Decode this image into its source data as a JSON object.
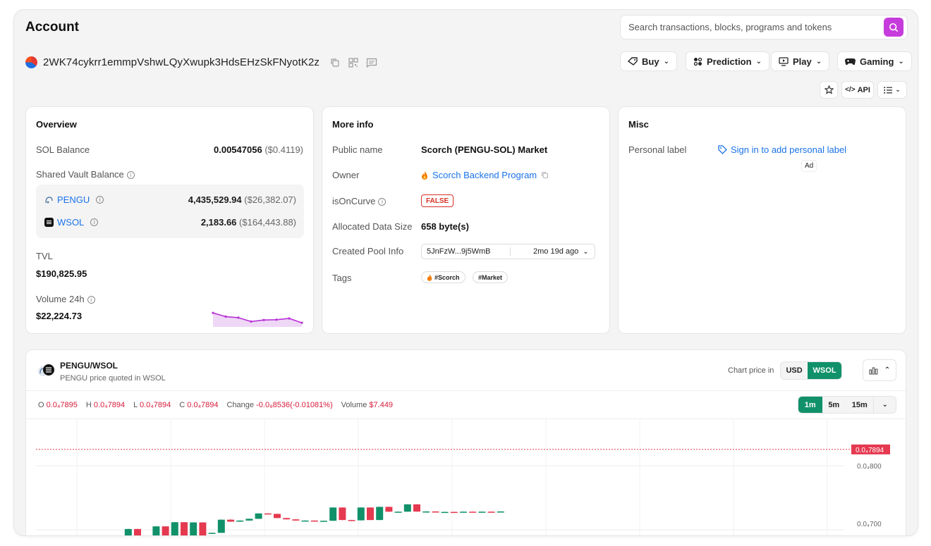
{
  "header": {
    "title": "Account",
    "search_placeholder": "Search transactions, blocks, programs and tokens"
  },
  "account": {
    "address": "2WK74cykrr1emmpVshwLQyXwupk3HdsEHzSkFNyotK2z"
  },
  "nav": {
    "buy": "Buy",
    "prediction": "Prediction",
    "play": "Play",
    "gaming": "Gaming",
    "api": "API"
  },
  "overview": {
    "title": "Overview",
    "sol_balance_label": "SOL Balance",
    "sol_balance_value": "0.00547056",
    "sol_balance_usd": "($0.4119)",
    "vault_label": "Shared Vault Balance",
    "vault": [
      {
        "token": "PENGU",
        "amount": "4,435,529.94",
        "usd": "($26,382.07)"
      },
      {
        "token": "WSOL",
        "amount": "2,183.66",
        "usd": "($164,443.88)"
      }
    ],
    "tvl_label": "TVL",
    "tvl_value": "$190,825.95",
    "volume_label": "Volume 24h",
    "volume_value": "$22,224.73",
    "sparkline": [
      0.86,
      0.62,
      0.55,
      0.3,
      0.4,
      0.42,
      0.5,
      0.22
    ]
  },
  "more_info": {
    "title": "More info",
    "public_name_label": "Public name",
    "public_name_value": "Scorch (PENGU-SOL) Market",
    "owner_label": "Owner",
    "owner_value": "Scorch Backend Program",
    "is_on_curve_label": "isOnCurve",
    "is_on_curve_value": "FALSE",
    "data_size_label": "Allocated Data Size",
    "data_size_value": "658 byte(s)",
    "pool_label": "Created Pool Info",
    "pool_tx": "5JnFzW...9j5WmB",
    "pool_age": "2mo 19d ago",
    "tags_label": "Tags",
    "tags": [
      "#Scorch",
      "#Market"
    ]
  },
  "misc": {
    "title": "Misc",
    "personal_label": "Personal label",
    "sign_in_link": "Sign in to add personal label",
    "ad": "Ad"
  },
  "chart_panel": {
    "pair": "PENGU/WSOL",
    "subtitle": "PENGU price quoted in WSOL",
    "price_in_label": "Chart price in",
    "currency_options": [
      "USD",
      "WSOL"
    ],
    "currency_selected": "WSOL",
    "intervals": [
      "1m",
      "5m",
      "15m"
    ],
    "interval_selected": "1m",
    "ohlc": {
      "o_label": "O",
      "o": "0.0₄7895",
      "h_label": "H",
      "h": "0.0₄7894",
      "l_label": "L",
      "l": "0.0₄7894",
      "c_label": "C",
      "c": "0.0₄7894",
      "change_label": "Change",
      "change": "-0.0₈8536(-0.01081%)",
      "volume_label": "Volume",
      "volume": "$7.449"
    },
    "y_label_upper": "0.0₄800",
    "y_label_lower": "0.0₄700",
    "last_price": "0.0₄7894"
  },
  "chart_data": {
    "type": "candlestick",
    "ylim": [
      7e-05,
      8.17e-05
    ],
    "y_ticks": [
      8e-05,
      7e-05
    ],
    "last_price": 7.894e-05,
    "candles": [
      [
        7.052e-05,
        7.047e-05,
        7.055e-05,
        7.043e-05
      ],
      [
        7.047e-05,
        7.033e-05,
        7.049e-05,
        7.029e-05
      ],
      [
        7.034e-05,
        7.038e-05,
        7.04e-05,
        7.032e-05
      ],
      [
        7.036e-05,
        7.04e-05,
        7.043e-05,
        7.035e-05
      ],
      [
        7.038e-05,
        7.06e-05,
        7.062e-05,
        7.037e-05
      ],
      [
        7.06e-05,
        7.033e-05,
        7.062e-05,
        7.03e-05
      ],
      [
        7.033e-05,
        7.048e-05,
        7.05e-05,
        7.031e-05
      ],
      [
        7.048e-05,
        7.054e-05,
        7.056e-05,
        7.046e-05
      ],
      [
        7.054e-05,
        7.047e-05,
        7.056e-05,
        7.045e-05
      ],
      [
        7.047e-05,
        7.168e-05,
        7.17e-05,
        7.046e-05
      ],
      [
        7.168e-05,
        7.035e-05,
        7.17e-05,
        7.033e-05
      ],
      [
        7.064e-05,
        7.079e-05,
        7.081e-05,
        7.062e-05
      ],
      [
        7.079e-05,
        7.192e-05,
        7.194e-05,
        7.078e-05
      ],
      [
        7.192e-05,
        7.107e-05,
        7.194e-05,
        7.105e-05
      ],
      [
        7.107e-05,
        7.23e-05,
        7.232e-05,
        7.106e-05
      ],
      [
        7.23e-05,
        7.106e-05,
        7.232e-05,
        7.104e-05
      ],
      [
        7.106e-05,
        7.228e-05,
        7.23e-05,
        7.105e-05
      ],
      [
        7.228e-05,
        7.106e-05,
        7.23e-05,
        7.104e-05
      ],
      [
        7.125e-05,
        7.133e-05,
        7.135e-05,
        7.123e-05
      ],
      [
        7.133e-05,
        7.253e-05,
        7.255e-05,
        7.132e-05
      ],
      [
        7.253e-05,
        7.235e-05,
        7.257e-05,
        7.233e-05
      ],
      [
        7.235e-05,
        7.245e-05,
        7.247e-05,
        7.233e-05
      ],
      [
        7.245e-05,
        7.261e-05,
        7.263e-05,
        7.244e-05
      ],
      [
        7.261e-05,
        7.31e-05,
        7.312e-05,
        7.26e-05
      ],
      [
        7.31e-05,
        7.306e-05,
        7.312e-05,
        7.304e-05
      ],
      [
        7.306e-05,
        7.268e-05,
        7.308e-05,
        7.266e-05
      ],
      [
        7.268e-05,
        7.256e-05,
        7.27e-05,
        7.254e-05
      ],
      [
        7.256e-05,
        7.245e-05,
        7.258e-05,
        7.243e-05
      ],
      [
        7.245e-05,
        7.245e-05,
        7.247e-05,
        7.243e-05
      ],
      [
        7.245e-05,
        7.24e-05,
        7.247e-05,
        7.238e-05
      ],
      [
        7.24e-05,
        7.243e-05,
        7.245e-05,
        7.238e-05
      ],
      [
        7.243e-05,
        7.364e-05,
        7.366e-05,
        7.242e-05
      ],
      [
        7.364e-05,
        7.25e-05,
        7.366e-05,
        7.248e-05
      ],
      [
        7.25e-05,
        7.247e-05,
        7.252e-05,
        7.245e-05
      ],
      [
        7.247e-05,
        7.364e-05,
        7.366e-05,
        7.246e-05
      ],
      [
        7.364e-05,
        7.25e-05,
        7.366e-05,
        7.248e-05
      ],
      [
        7.25e-05,
        7.37e-05,
        7.372e-05,
        7.249e-05
      ],
      [
        7.37e-05,
        7.326e-05,
        7.372e-05,
        7.324e-05
      ],
      [
        7.326e-05,
        7.326e-05,
        7.328e-05,
        7.324e-05
      ],
      [
        7.326e-05,
        7.393e-05,
        7.395e-05,
        7.325e-05
      ],
      [
        7.393e-05,
        7.327e-05,
        7.395e-05,
        7.325e-05
      ],
      [
        7.327e-05,
        7.328e-05,
        7.33e-05,
        7.326e-05
      ],
      [
        7.328e-05,
        7.322e-05,
        7.33e-05,
        7.32e-05
      ],
      [
        7.322e-05,
        7.324e-05,
        7.326e-05,
        7.32e-05
      ],
      [
        7.324e-05,
        7.323e-05,
        7.326e-05,
        7.321e-05
      ],
      [
        7.323e-05,
        7.326e-05,
        7.328e-05,
        7.321e-05
      ],
      [
        7.326e-05,
        7.322e-05,
        7.328e-05,
        7.32e-05
      ],
      [
        7.322e-05,
        7.326e-05,
        7.328e-05,
        7.32e-05
      ],
      [
        7.326e-05,
        7.322e-05,
        7.328e-05,
        7.32e-05
      ],
      [
        7.322e-05,
        7.328e-05,
        7.33e-05,
        7.32e-05
      ]
    ]
  }
}
